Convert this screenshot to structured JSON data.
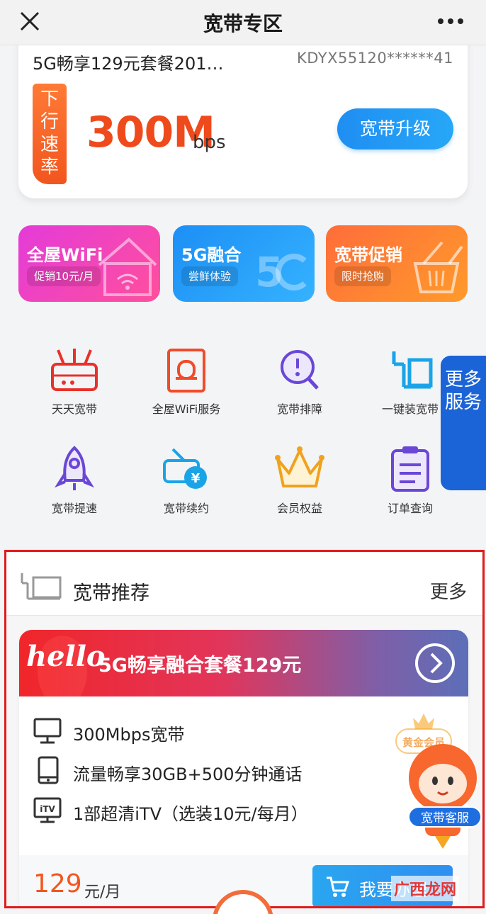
{
  "header": {
    "title": "宽带专区",
    "close_icon": "close-icon",
    "more_icon": "more-dots-icon"
  },
  "account": {
    "plan_name": "5G畅享129元套餐201…",
    "account_no": "KDYX55120******41",
    "speed_tag": "下行速率",
    "speed_value": "300M",
    "speed_unit": "bps",
    "upgrade_label": "宽带升级"
  },
  "promos": [
    {
      "title": "全屋WiFi",
      "tag": "促销10元/月",
      "icon": "house-wifi-icon"
    },
    {
      "title": "5G融合",
      "tag": "尝鲜体验",
      "icon": "5g-logo-icon"
    },
    {
      "title": "宽带促销",
      "tag": "限时抢购",
      "icon": "shopping-basket-icon"
    }
  ],
  "services": [
    {
      "label": "天天宽带",
      "icon": "router-icon"
    },
    {
      "label": "全屋WiFi服务",
      "icon": "wifi-device-icon"
    },
    {
      "label": "宽带排障",
      "icon": "troubleshoot-search-icon"
    },
    {
      "label": "一键装宽带",
      "icon": "install-cable-icon"
    },
    {
      "label": "宽带提速",
      "icon": "rocket-icon"
    },
    {
      "label": "宽带续约",
      "icon": "renew-yuan-icon"
    },
    {
      "label": "会员权益",
      "icon": "crown-icon"
    },
    {
      "label": "订单查询",
      "icon": "clipboard-icon"
    }
  ],
  "more_services": "更多服务",
  "recommend": {
    "title": "宽带推荐",
    "more": "更多",
    "package": {
      "hello": "hello",
      "title": "5G畅享融合套餐129元",
      "features": [
        {
          "text": "300Mbps宽带",
          "icon": "monitor-icon"
        },
        {
          "text": "流量畅享30GB+500分钟通话",
          "icon": "phone-icon"
        },
        {
          "text": "1部超清iTV（选装10元/每月）",
          "icon": "itv-icon"
        }
      ],
      "badge": "黄金会员",
      "price": "129",
      "price_unit": "元/月",
      "apply_label": "我要办理"
    }
  },
  "mascot_label": "宽带客服",
  "watermark": "广西龙网",
  "colors": {
    "accent_blue": "#1f8ef2",
    "accent_orange": "#ef4a1c",
    "highlight_red": "#e01b1b"
  }
}
